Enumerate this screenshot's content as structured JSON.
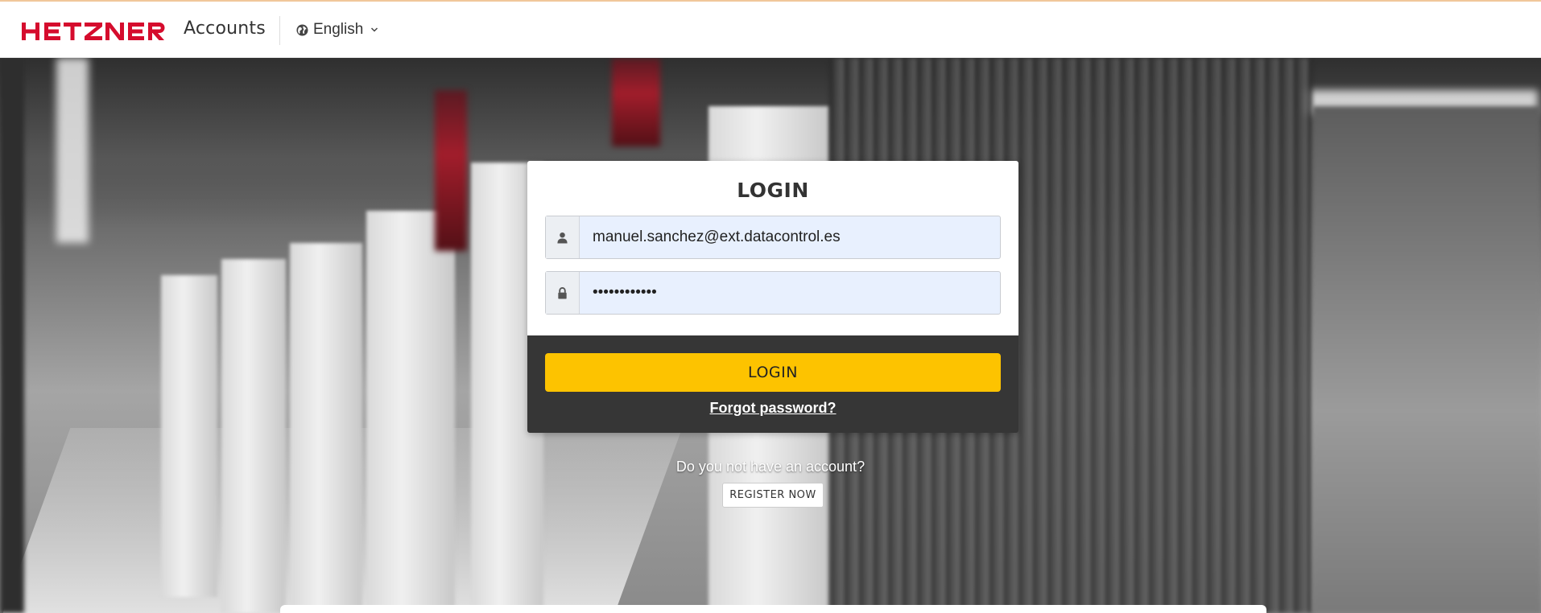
{
  "header": {
    "logo_text": "HETZNER",
    "app_name": "Accounts",
    "language": "English",
    "brand_color": "#d50c2d"
  },
  "login": {
    "title": "LOGIN",
    "username_value": "manuel.sanchez@ext.datacontrol.es",
    "password_value": "••••••••••••",
    "submit_label": "LOGIN",
    "forgot_label": "Forgot password?",
    "accent_color": "#fdc300"
  },
  "register": {
    "prompt": "Do you not have an account?",
    "button_label": "REGISTER NOW"
  },
  "icons": {
    "user": "user-icon",
    "password": "lock-icon",
    "language": "globe-icon",
    "dropdown": "chevron-down-icon"
  }
}
